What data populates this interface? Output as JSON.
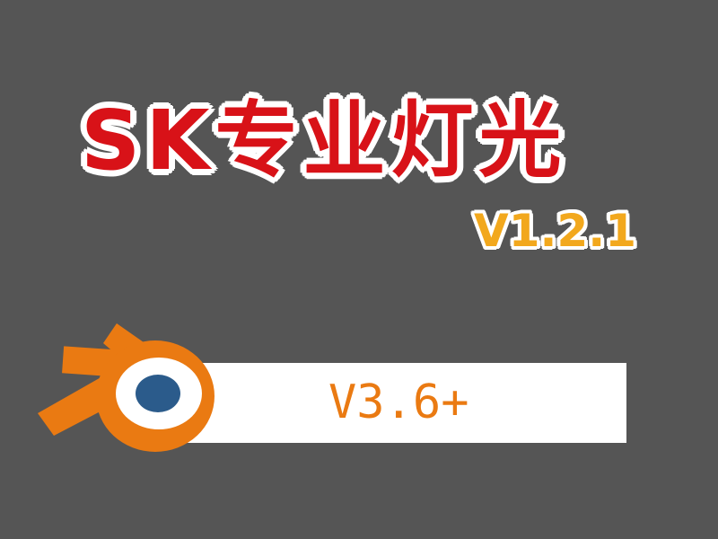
{
  "title": "SK专业灯光",
  "version": "V1.2.1",
  "requirement": "V3.6+",
  "logo": {
    "icon": "blender-logo-icon",
    "outer_color": "#ea7a12",
    "ring_color": "#ffffff",
    "core_color": "#2b5b8b"
  },
  "colors": {
    "background": "#555555",
    "title": "#d81218",
    "version": "#f2a81d",
    "requirement": "#ea7a12"
  }
}
